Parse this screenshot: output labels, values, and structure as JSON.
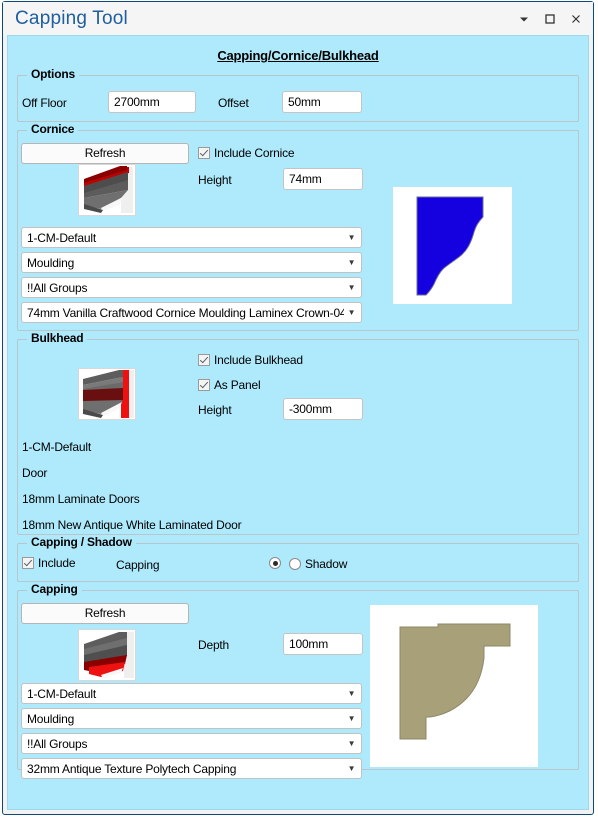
{
  "window": {
    "title": "Capping Tool",
    "buttons": [
      {
        "name": "dropdown-button",
        "glyph": "chevron-down-icon"
      },
      {
        "name": "maximize-button",
        "glyph": "maximize-icon"
      },
      {
        "name": "close-button",
        "glyph": "close-icon"
      }
    ]
  },
  "page": {
    "heading": "Capping/Cornice/Bulkhead",
    "background_color": "#aeeafc",
    "title_color": "#1f5fa0"
  },
  "options": {
    "title": "Options",
    "off_floor_label": "Off Floor",
    "off_floor_value": "2700mm",
    "offset_label": "Offset",
    "offset_value": "50mm"
  },
  "cornice": {
    "title": "Cornice",
    "refresh_label": "Refresh",
    "include_label": "Include Cornice",
    "include_checked": true,
    "height_label": "Height",
    "height_value": "74mm",
    "combos": [
      "1-CM-Default",
      "Moulding",
      "!!All Groups",
      "74mm Vanilla Craftwood Cornice Moulding Laminex Crown-04"
    ],
    "preview_color": "#1500e0"
  },
  "bulkhead": {
    "title": "Bulkhead",
    "include_label": "Include Bulkhead",
    "include_checked": true,
    "as_panel_label": "As Panel",
    "as_panel_checked": true,
    "height_label": "Height",
    "height_value": "-300mm",
    "lines": [
      "1-CM-Default",
      "Door",
      "18mm Laminate Doors",
      "18mm New Antique White Laminated Door"
    ]
  },
  "capping_shadow": {
    "title": "Capping / Shadow",
    "include_label": "Include",
    "include_checked": true,
    "capping_radio_label": "Capping",
    "capping_selected": true,
    "shadow_radio_label": "Shadow",
    "shadow_selected": false
  },
  "capping": {
    "title": "Capping",
    "refresh_label": "Refresh",
    "depth_label": "Depth",
    "depth_value": "100mm",
    "combos": [
      "1-CM-Default",
      "Moulding",
      "!!All Groups",
      "32mm Antique Texture Polytech Capping"
    ],
    "preview_color": "#a8a078"
  }
}
